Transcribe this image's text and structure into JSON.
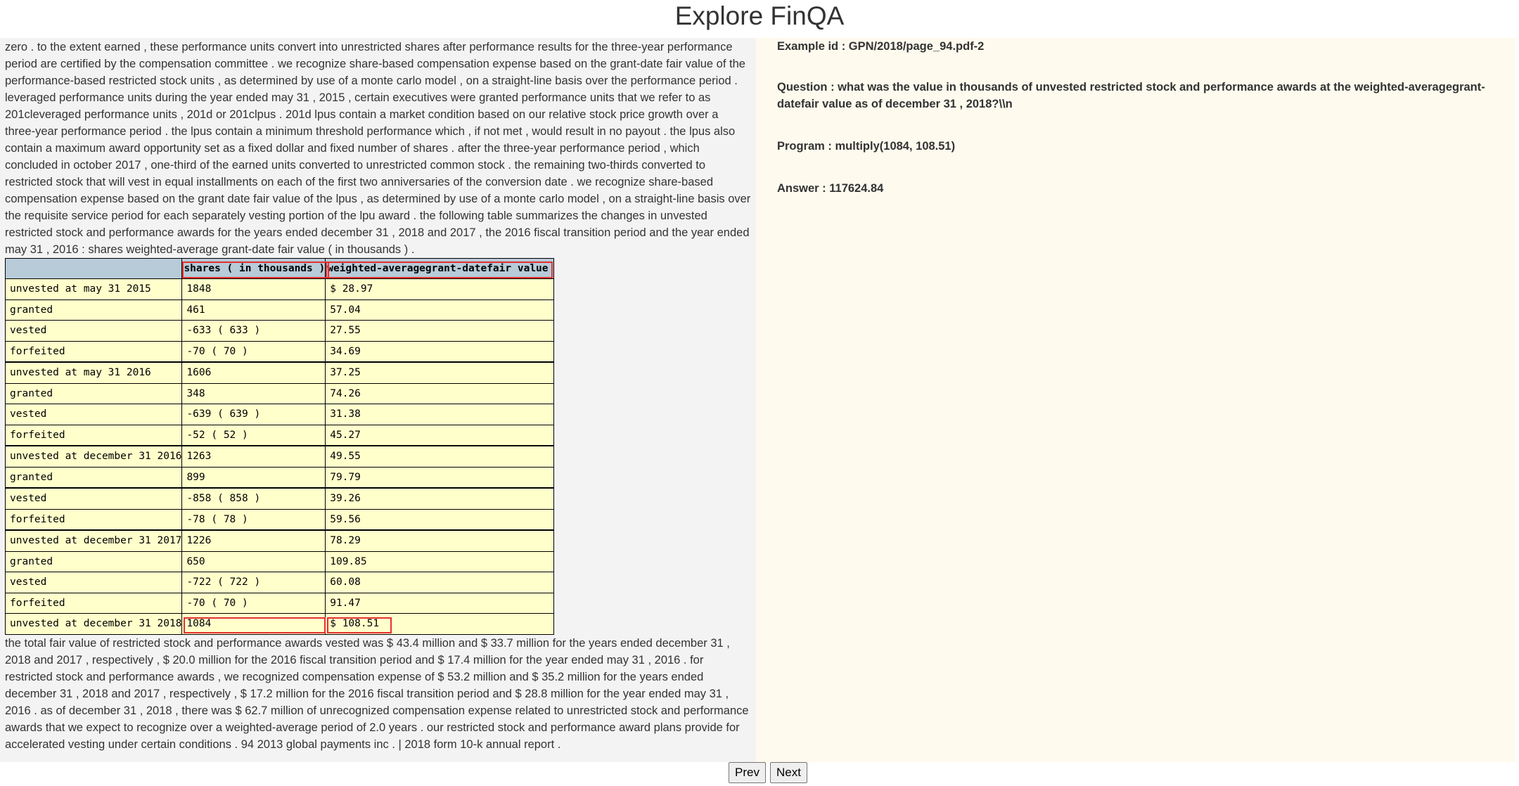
{
  "page": {
    "title": "Explore FinQA"
  },
  "passage": {
    "pre_text": "zero . to the extent earned , these performance units convert into unrestricted shares after performance results for the three-year performance period are certified by the compensation committee . we recognize share-based compensation expense based on the grant-date fair value of the performance-based restricted stock units , as determined by use of a monte carlo model , on a straight-line basis over the performance period . leveraged performance units during the year ended may 31 , 2015 , certain executives were granted performance units that we refer to as 201cleveraged performance units , 201d or 201clpus . 201d lpus contain a market condition based on our relative stock price growth over a three-year performance period . the lpus contain a minimum threshold performance which , if not met , would result in no payout . the lpus also contain a maximum award opportunity set as a fixed dollar and fixed number of shares . after the three-year performance period , which concluded in october 2017 , one-third of the earned units converted to unrestricted common stock . the remaining two-thirds converted to restricted stock that will vest in equal installments on each of the first two anniversaries of the conversion date . we recognize share-based compensation expense based on the grant date fair value of the lpus , as determined by use of a monte carlo model , on a straight-line basis over the requisite service period for each separately vesting portion of the lpu award . the following table summarizes the changes in unvested restricted stock and performance awards for the years ended december 31 , 2018 and 2017 , the 2016 fiscal transition period and the year ended may 31 , 2016 : shares weighted-average grant-date fair value ( in thousands ) .",
    "post_text": "the total fair value of restricted stock and performance awards vested was $ 43.4 million and $ 33.7 million for the years ended december 31 , 2018 and 2017 , respectively , $ 20.0 million for the 2016 fiscal transition period and $ 17.4 million for the year ended may 31 , 2016 . for restricted stock and performance awards , we recognized compensation expense of $ 53.2 million and $ 35.2 million for the years ended december 31 , 2018 and 2017 , respectively , $ 17.2 million for the 2016 fiscal transition period and $ 28.8 million for the year ended may 31 , 2016 . as of december 31 , 2018 , there was $ 62.7 million of unrecognized compensation expense related to unrestricted stock and performance awards that we expect to recognize over a weighted-average period of 2.0 years . our restricted stock and performance award plans provide for accelerated vesting under certain conditions . 94 2013 global payments inc . | 2018 form 10-k annual report ."
  },
  "table": {
    "headers": [
      "",
      "shares ( in thousands )",
      "weighted-averagegrant-datefair value"
    ],
    "rows": [
      {
        "label": "unvested at may 31 2015",
        "shares": "1848",
        "value": "$ 28.97"
      },
      {
        "label": "granted",
        "shares": "461",
        "value": "57.04"
      },
      {
        "label": "vested",
        "shares": "-633 ( 633 )",
        "value": "27.55"
      },
      {
        "label": "forfeited",
        "shares": "-70 ( 70 )",
        "value": "34.69"
      },
      {
        "label": "unvested at may 31 2016",
        "shares": "1606",
        "value": "37.25"
      },
      {
        "label": "granted",
        "shares": "348",
        "value": "74.26"
      },
      {
        "label": "vested",
        "shares": "-639 ( 639 )",
        "value": "31.38"
      },
      {
        "label": "forfeited",
        "shares": "-52 ( 52 )",
        "value": "45.27"
      },
      {
        "label": "unvested at december 31 2016",
        "shares": "1263",
        "value": "49.55"
      },
      {
        "label": "granted",
        "shares": "899",
        "value": "79.79"
      },
      {
        "label": "vested",
        "shares": "-858 ( 858 )",
        "value": "39.26"
      },
      {
        "label": "forfeited",
        "shares": "-78 ( 78 )",
        "value": "59.56"
      },
      {
        "label": "unvested at december 31 2017",
        "shares": "1226",
        "value": "78.29"
      },
      {
        "label": "granted",
        "shares": "650",
        "value": "109.85"
      },
      {
        "label": "vested",
        "shares": "-722 ( 722 )",
        "value": "60.08"
      },
      {
        "label": "forfeited",
        "shares": "-70 ( 70 )",
        "value": "91.47"
      },
      {
        "label": "unvested at december 31 2018",
        "shares": "1084",
        "value": "$ 108.51"
      }
    ]
  },
  "qa": {
    "example_id": "Example id : GPN/2018/page_94.pdf-2",
    "question": "Question : what was the value in thousands of unvested restricted stock and performance awards at the weighted-averagegrant-datefair value as of december 31 , 2018?\\\\n",
    "program": "Program : multiply(1084, 108.51)",
    "answer": "Answer : 117624.84"
  },
  "nav": {
    "prev_label": "Prev",
    "next_label": "Next"
  },
  "colors": {
    "left_panel_bg": "#f3f3f3",
    "right_panel_bg": "#fefaee",
    "table_cell_bg": "#ffffcc",
    "table_header_bg": "#b7cbd9",
    "highlight": "#e53030"
  }
}
